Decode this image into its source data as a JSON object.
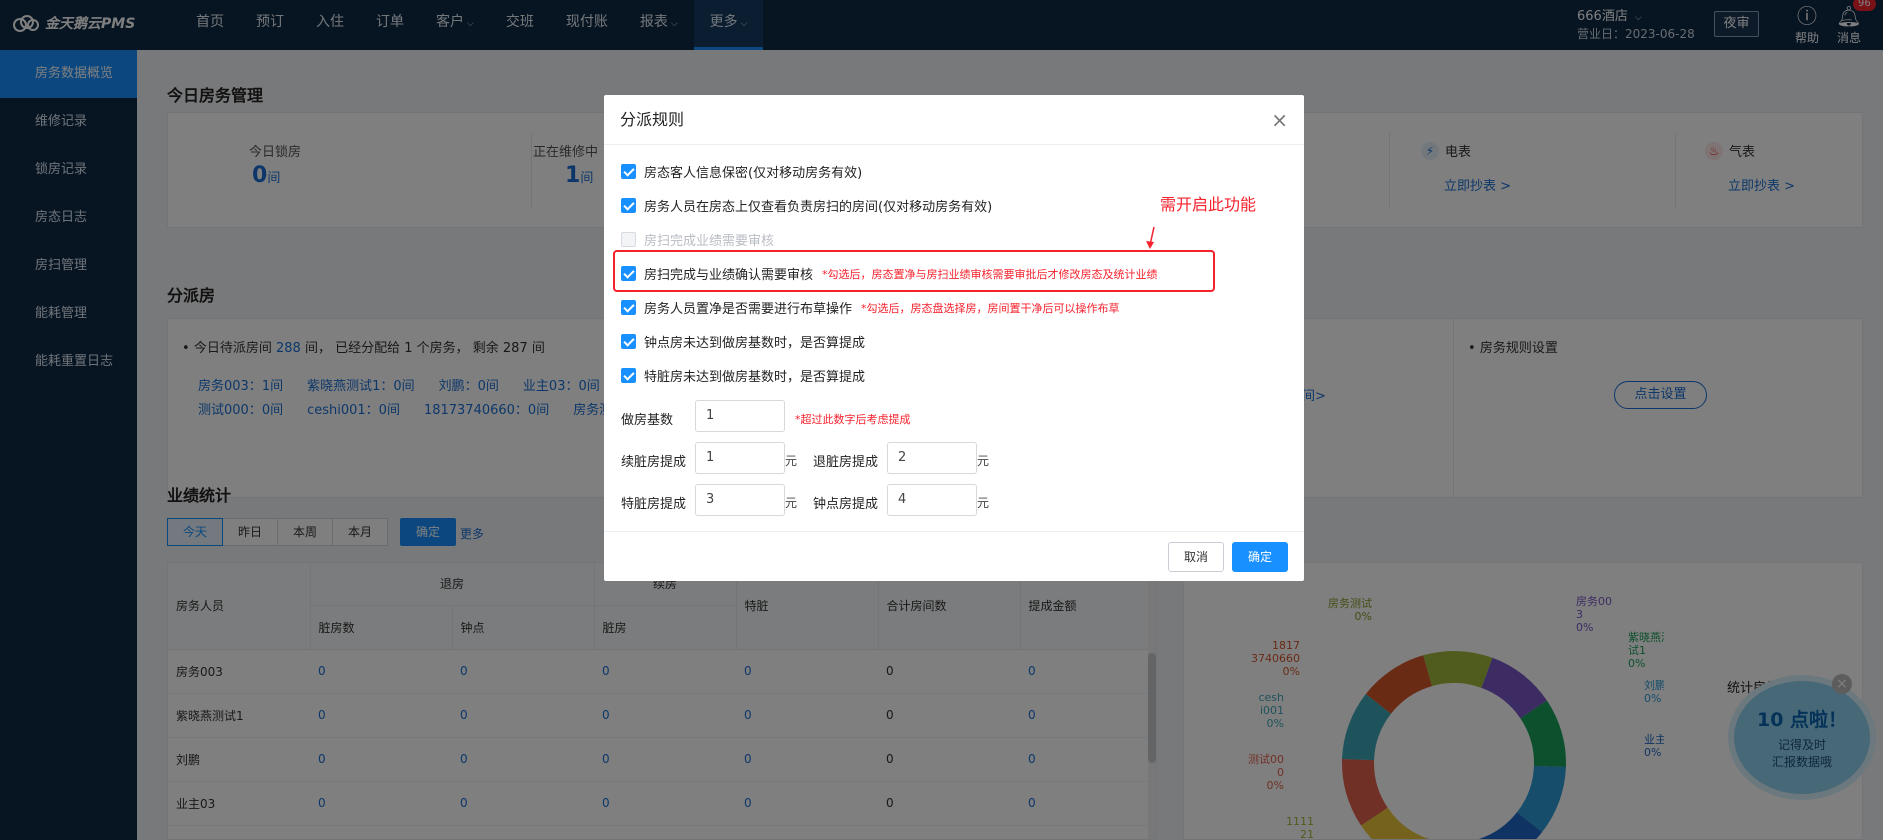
{
  "app": {
    "name": "金天鹅云PMS"
  },
  "nav": {
    "items": [
      "首页",
      "预订",
      "入住",
      "订单",
      "客户",
      "交班",
      "现付账",
      "报表",
      "更多"
    ]
  },
  "header": {
    "hotel": "666酒店",
    "biz_date": "营业日：2023-06-28",
    "night_audit": "夜审",
    "help": "帮助",
    "messages": "消息",
    "badge": "96"
  },
  "sidebar": {
    "items": [
      "房务数据概览",
      "维修记录",
      "锁房记录",
      "房态日志",
      "房扫管理",
      "能耗管理",
      "能耗重置日志"
    ]
  },
  "today": {
    "title": "今日房务管理",
    "lock_label": "今日锁房",
    "lock_value": "0",
    "lock_unit": "间",
    "repair_label": "正在维修中",
    "repair_value": "1",
    "repair_unit": "间",
    "electric_label": "电表",
    "electric_link": "立即抄表 >",
    "gas_label": "气表",
    "gas_link": "立即抄表 >"
  },
  "assign": {
    "title": "分派房",
    "summary_a": "今日待派房间",
    "summary_num": "288",
    "summary_b": "间， 已经分配给 1 个房务， 剩余 287 间",
    "staff_row1": [
      "房务003：1间",
      "紫晓燕测试1：0间",
      "刘鹏：0间",
      "业主03：0间"
    ],
    "staff_row2": [
      "测试000：0间",
      "ceshi001：0间",
      "18173740660：0间",
      "房务测"
    ],
    "link_partial": "间>",
    "rules_label": "房务规则设置",
    "rules_btn": "点击设置"
  },
  "perf": {
    "title": "业绩统计",
    "tabs": [
      "今天",
      "昨日",
      "本周",
      "本月"
    ],
    "confirm": "确定",
    "more": "更多",
    "headers": {
      "staff": "房务人员",
      "checkout": "退房",
      "stay": "续房",
      "dirty": "脏房数",
      "clock": "钟点",
      "stay_dirty": "脏房",
      "special": "特脏",
      "total": "合计房间数",
      "amount": "提成金额"
    },
    "rows": [
      [
        "房务003",
        "0",
        "0",
        "0",
        "0",
        "0",
        "0"
      ],
      [
        "紫晓燕测试1",
        "0",
        "0",
        "0",
        "0",
        "0",
        "0"
      ],
      [
        "刘鹏",
        "0",
        "0",
        "0",
        "0",
        "0",
        "0"
      ],
      [
        "业主03",
        "0",
        "0",
        "0",
        "0",
        "0",
        "0"
      ]
    ]
  },
  "donut": {
    "labels": [
      "房务测试\n0%",
      "房务00\n3\n0%",
      "紫晓燕测\n试1\n0%",
      "刘鹏\n0%",
      "业主03\n0%",
      "1817\n3740660\n0%",
      "cesh\ni001\n0%",
      "测试00\n0\n0%",
      "1111\n21"
    ],
    "stat_title": "统计房扫数",
    "colors": [
      "#7a57c8",
      "#1aa05a",
      "#2b9ad6",
      "#1f66c4",
      "#e4822c",
      "#e8c43a",
      "#e0604a",
      "#3ea6b8",
      "#d4572a",
      "#a0b83a"
    ]
  },
  "promo": {
    "title": "10 点啦！",
    "line1": "记得及时",
    "line2": "汇报数据哦"
  },
  "modal": {
    "title": "分派规则",
    "options": [
      {
        "label": "房态客人信息保密(仅对移动房务有效)",
        "checked": true
      },
      {
        "label": "房务人员在房态上仅查看负责房扫的房间(仅对移动房务有效)",
        "checked": true
      },
      {
        "label": "房扫完成业绩需要审核",
        "checked": false
      },
      {
        "label": "房扫完成与业绩确认需要审核",
        "checked": true,
        "note": "*勾选后，房态置净与房扫业绩审核需要审批后才修改房态及统计业绩"
      },
      {
        "label": "房务人员置净是否需要进行布草操作",
        "checked": true,
        "note": "*勾选后，房态盘选择房，房间置干净后可以操作布草"
      },
      {
        "label": "钟点房未达到做房基数时，是否算提成",
        "checked": true
      },
      {
        "label": "特脏房未达到做房基数时，是否算提成",
        "checked": true
      }
    ],
    "callout": "需开启此功能",
    "base_label": "做房基数",
    "base_value": "1",
    "base_note": "*超过此数字后考虑提成",
    "stay_dirty_label": "续脏房提成",
    "stay_dirty_value": "1",
    "checkout_dirty_label": "退脏房提成",
    "checkout_dirty_value": "2",
    "special_label": "特脏房提成",
    "special_value": "3",
    "clock_label": "钟点房提成",
    "clock_value": "4",
    "unit": "元",
    "cancel": "取消",
    "ok": "确定"
  }
}
